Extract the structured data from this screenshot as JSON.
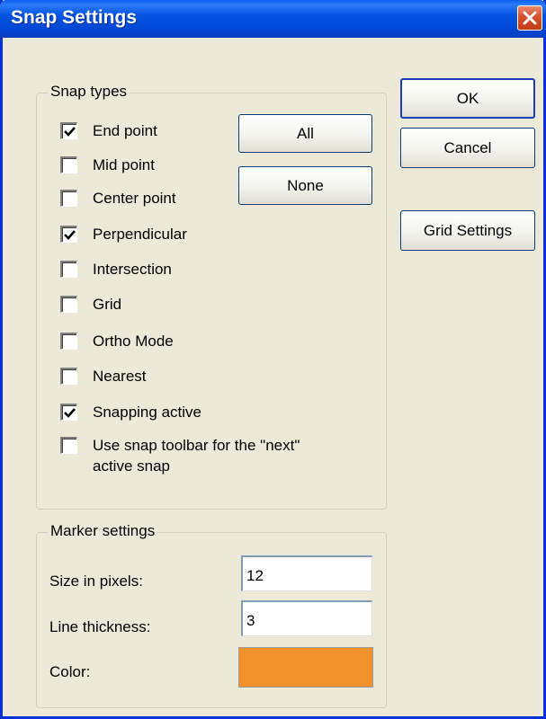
{
  "window": {
    "title": "Snap Settings"
  },
  "snap_types": {
    "legend": "Snap types",
    "items": [
      {
        "label": "End point",
        "checked": true
      },
      {
        "label": "Mid point",
        "checked": false
      },
      {
        "label": "Center point",
        "checked": false
      },
      {
        "label": "Perpendicular",
        "checked": true
      },
      {
        "label": "Intersection",
        "checked": false
      },
      {
        "label": "Grid",
        "checked": false
      },
      {
        "label": "Ortho Mode",
        "checked": false
      },
      {
        "label": "Nearest",
        "checked": false
      },
      {
        "label": "Snapping active",
        "checked": true
      },
      {
        "label": "Use snap toolbar for the \"next\"",
        "label2": "active snap",
        "checked": false
      }
    ],
    "all_label": "All",
    "none_label": "None"
  },
  "buttons": {
    "ok_label": "OK",
    "cancel_label": "Cancel",
    "grid_settings_label": "Grid Settings"
  },
  "marker_settings": {
    "legend": "Marker settings",
    "size_label": "Size in pixels:",
    "size_value": "12",
    "thickness_label": "Line thickness:",
    "thickness_value": "3",
    "color_label": "Color:",
    "color_value": "#f0922b"
  },
  "colors": {
    "accent": "#0454e3",
    "close": "#d6502d"
  }
}
